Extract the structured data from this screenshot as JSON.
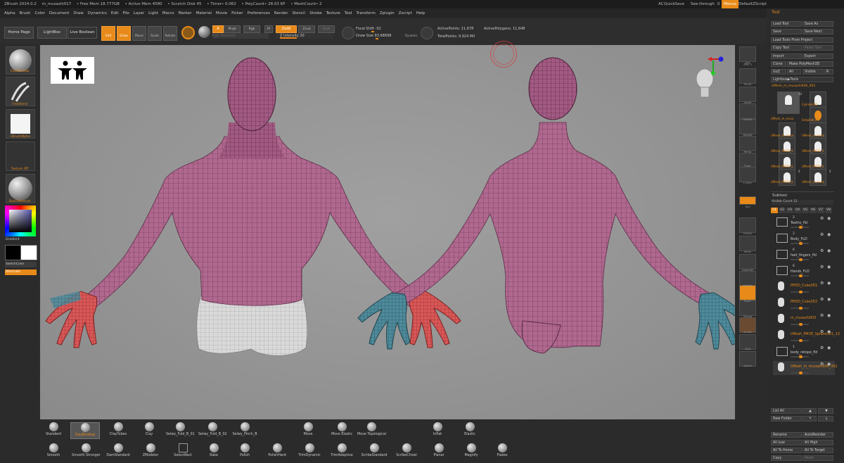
{
  "titlebar": {
    "app": "ZBrush 2024.0.2",
    "file": "m_musashi017",
    "free_mem": "• Free Mem 18.777GB",
    "active_mem": "• Active Mem 4580",
    "scratch": "• Scratch Disk 45",
    "timer": "• Timer• 0.062",
    "polycount": "• PolyCount• 28.03 KP",
    "meshcount": "• MeshCount• 2",
    "ac": "AC",
    "quicksave": "QuickSave",
    "seethrough": "See-through",
    "seethrough_val": "0",
    "menus": "Menus",
    "script": "DefaultZScript"
  },
  "menubar": [
    "Alpha",
    "Brush",
    "Color",
    "Document",
    "Draw",
    "Dynamics",
    "Edit",
    "File",
    "Layer",
    "Light",
    "Macro",
    "Marker",
    "Material",
    "Movie",
    "Picker",
    "Preferences",
    "Render",
    "Stencil",
    "Stroke",
    "Texture",
    "Tool",
    "Transform",
    "Zplugin",
    "Zscript",
    "Help"
  ],
  "shelf": {
    "home": "Home Page",
    "lightbox": "LightBox",
    "live_boolean": "Live Boolean",
    "edit": "Edit",
    "draw": "Draw",
    "move": "Move",
    "scale": "Scale",
    "rotate": "Rotate",
    "a": "A",
    "mrgb": "Mrgb",
    "rgb": "Rgb",
    "m": "M",
    "zadd": "Zadd",
    "zsub": "Zsub",
    "zcut": "Zcut",
    "rgb_intensity": "Rgb Intensity",
    "z_intensity": "Z Intensity",
    "z_intensity_val": "20",
    "focal_shift": "Focal Shift",
    "focal_shift_val": "-52",
    "draw_size": "Draw Size",
    "draw_size_val": "93.68698",
    "dynamic": "Dynamic",
    "active_points": "ActivePoints: 11,678",
    "total_points": "TotalPoints: 9.924 Mil",
    "active_polys": "ActivePolygons: 11,648"
  },
  "left": {
    "brush": "ClayBuildup",
    "stroke": "FreeHand",
    "alpha": "~BrushAlpha",
    "texture": "Texture Off",
    "material": "BasicMaterial",
    "gradient": "Gradient",
    "switch_color": "SwitchColor",
    "alternate": "Alternate"
  },
  "rstrip": [
    "BPR",
    "SPix",
    "Scroll",
    "Zoom",
    "Actual",
    "AAHalf",
    "Persp",
    "Floor",
    "L.Sym",
    "Xyz",
    "Frame",
    "Move",
    "Zoom3D",
    "Rotate",
    "PolyF",
    "Transp",
    "Ghost",
    "Solo",
    "Xpose"
  ],
  "rstrip_spix_val": "3",
  "tool": {
    "header": "Tool",
    "load_tool": "Load Tool",
    "save_as": "Save As",
    "save": "Save",
    "save_next": "Save Next",
    "load_from_project": "Load Tools From Project",
    "copy_tool": "Copy Tool",
    "paste_tool": "Paste Tool",
    "import": "Import",
    "export": "Export",
    "clone": "Clone",
    "make_polymesh": "Make PolyMesh3D",
    "goz": "GoZ",
    "all": "All",
    "visible": "Visible",
    "r": "R",
    "lightbox_tools": "Lightbox▶Tools",
    "current": "UMesh_m_musashi006_002",
    "tools": [
      {
        "name": "UMesh_m_musa",
        "n": "12"
      },
      {
        "name": "Cylinder3D",
        "n": ""
      },
      {
        "name": "SimpleBrush",
        "n": ""
      },
      {
        "name": "UMesh_m_musa",
        "n": ""
      },
      {
        "name": "UMesh_m_musa",
        "n": ""
      },
      {
        "name": "UMesh_PM3D_S",
        "n": ""
      },
      {
        "name": "UMesh_PM3D_S",
        "n": ""
      },
      {
        "name": "UMesh_PM3D_S",
        "n": ""
      },
      {
        "name": "UMesh_PM3D_S",
        "n": ""
      },
      {
        "name": "UMesh_PM3D_S",
        "n": "2"
      },
      {
        "name": "UMesh_m_musa",
        "n": "2"
      }
    ]
  },
  "subtool": {
    "header": "Subtool",
    "visible_count": "Visible Count",
    "visible_count_val": "12",
    "versions": [
      "V1",
      "V2",
      "V3",
      "V4",
      "V5",
      "V6",
      "V7",
      "V8"
    ],
    "items": [
      {
        "n": "2",
        "name": "Teeths_fld",
        "type": "folder"
      },
      {
        "n": "2",
        "name": "Body_FLD",
        "type": "folder"
      },
      {
        "n": "6",
        "name": "feet_fingers_fld",
        "type": "folder"
      },
      {
        "n": "6",
        "name": "Hands_FLD",
        "type": "folder"
      },
      {
        "n": "",
        "name": "PM3D_Cube3D1",
        "type": "mesh"
      },
      {
        "n": "",
        "name": "PM3D_Cube3D2",
        "type": "mesh"
      },
      {
        "n": "",
        "name": "m_musashi003",
        "type": "mesh"
      },
      {
        "n": "",
        "name": "UMesh_PM3D_Sphere3D1_13",
        "type": "mesh"
      },
      {
        "n": "1",
        "name": "body_retopo_fld",
        "type": "folder"
      },
      {
        "n": "",
        "name": "UMesh_m_musashi006_002",
        "type": "mesh"
      }
    ],
    "list_all": "List All",
    "new_folder": "New Folder",
    "rename": "Rename",
    "auto_reorder": "AutoReorder",
    "all_low": "All Low",
    "all_high": "All High",
    "all_to_home": "All To Home",
    "all_to_target": "All To Target",
    "copy": "Copy",
    "paste": "Paste"
  },
  "brushes_row1": [
    {
      "name": "Standard",
      "sel": false
    },
    {
      "name": "ClayBuildup",
      "sel": true
    },
    {
      "name": "ClayTubes",
      "sel": false
    },
    {
      "name": "Clay",
      "sel": false
    },
    {
      "name": "Selwy_Fold_B_01",
      "sel": false
    },
    {
      "name": "Selwy_Fold_B_02",
      "sel": false
    },
    {
      "name": "Selwy_Pinch_B",
      "sel": false
    },
    {
      "name": "Move",
      "sel": false
    },
    {
      "name": "Move Elastic",
      "sel": false
    },
    {
      "name": "Move Topological",
      "sel": false
    },
    {
      "name": "Inflat",
      "sel": false
    },
    {
      "name": "Elastic",
      "sel": false
    }
  ],
  "brushes_row2": [
    {
      "name": "Smooth"
    },
    {
      "name": "Smooth Stronger"
    },
    {
      "name": "DamStandard"
    },
    {
      "name": "ZModeler"
    },
    {
      "name": "SelectRect"
    },
    {
      "name": "Rake"
    },
    {
      "name": "Polish"
    },
    {
      "name": "PolishHard"
    },
    {
      "name": "TrimDynamic"
    },
    {
      "name": "TrimAdaptive"
    },
    {
      "name": "ScribeStandard"
    },
    {
      "name": "ScribeChisel"
    },
    {
      "name": "Planar"
    },
    {
      "name": "Magnify"
    },
    {
      "name": "Flakes"
    }
  ],
  "colors": {
    "accent": "#e88a19",
    "mesh": "#b0688f",
    "hand_red": "#d95757",
    "hand_teal": "#4e8a9a"
  }
}
